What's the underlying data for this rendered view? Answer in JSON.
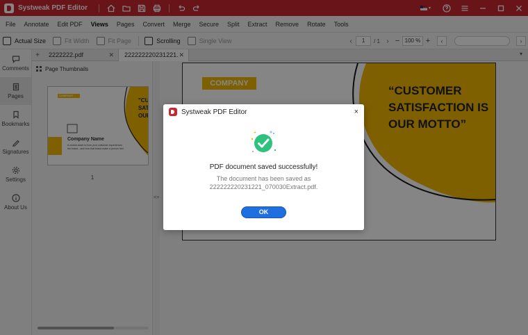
{
  "app": {
    "title": "Systweak PDF Editor"
  },
  "menu": [
    "File",
    "Annotate",
    "Edit PDF",
    "Views",
    "Pages",
    "Convert",
    "Merge",
    "Secure",
    "Split",
    "Extract",
    "Remove",
    "Rotate",
    "Tools"
  ],
  "menu_active": "Views",
  "viewbar": {
    "actual_size": "Actual Size",
    "fit_width": "Fit Width",
    "fit_page": "Fit Page",
    "scrolling": "Scrolling",
    "single_view": "Single View",
    "page_current": "1",
    "page_total": "/ 1",
    "zoom": "100 %"
  },
  "rail": [
    {
      "label": "Comments",
      "icon": "comment-icon"
    },
    {
      "label": "Pages",
      "icon": "pages-icon"
    },
    {
      "label": "Bookmarks",
      "icon": "bookmark-icon"
    },
    {
      "label": "Signatures",
      "icon": "signature-icon"
    },
    {
      "label": "Settings",
      "icon": "gear-icon"
    },
    {
      "label": "About Us",
      "icon": "info-icon"
    }
  ],
  "tabs": [
    {
      "label": "2222222.pdf"
    },
    {
      "label": "222222220231221..."
    }
  ],
  "thumbnails": {
    "heading": "Page Thumbnails",
    "page_number": "1",
    "mini_company": "COMPANY",
    "mini_quote": "\"CU SATIS OUR",
    "mini_name": "Company Name",
    "mini_text": "A comes down to how your customer experiences the brand - and how that brand make a person feel."
  },
  "document": {
    "company": "COMPANY",
    "quote_lines": [
      "“CUSTOMER",
      "SATISFACTION IS",
      "OUR MOTTO”"
    ],
    "accent_color": "#f4b800"
  },
  "dialog": {
    "title": "Systweak PDF Editor",
    "close": "×",
    "message": "PDF document saved successfully!",
    "sub_line1": "The document has been saved as",
    "sub_line2": "222222220231221_070030Extract.pdf.",
    "ok": "OK"
  },
  "colors": {
    "brand": "#c9272f",
    "accent": "#f4b800",
    "ok_button": "#1f6fe0",
    "success": "#2ec27e"
  }
}
